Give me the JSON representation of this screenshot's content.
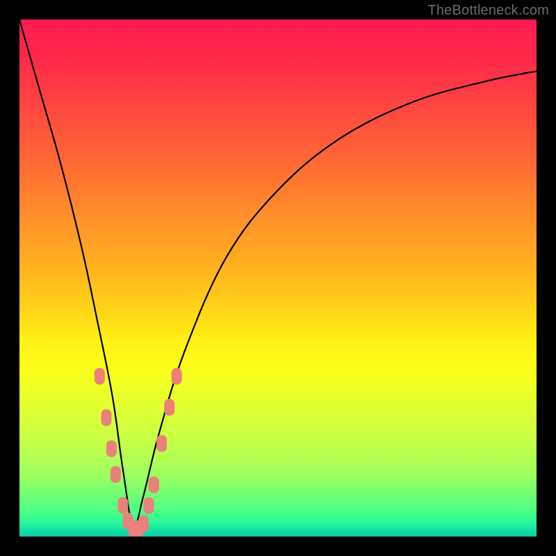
{
  "watermark": "TheBottleneck.com",
  "frame": {
    "outer_size_px": 800,
    "border_px": 28,
    "border_color": "#000000"
  },
  "gradient": {
    "direction": "vertical",
    "stops": [
      {
        "pos": 0.0,
        "color": "#ff1a52"
      },
      {
        "pos": 0.18,
        "color": "#ff4a3f"
      },
      {
        "pos": 0.38,
        "color": "#ff8f29"
      },
      {
        "pos": 0.56,
        "color": "#ffd317"
      },
      {
        "pos": 0.68,
        "color": "#faff1a"
      },
      {
        "pos": 0.8,
        "color": "#cdff40"
      },
      {
        "pos": 0.92,
        "color": "#6fff74"
      },
      {
        "pos": 1.0,
        "color": "#0bcba8"
      }
    ]
  },
  "chart_data": {
    "type": "line",
    "title": "",
    "xlabel": "",
    "ylabel": "",
    "xlim": [
      0,
      100
    ],
    "ylim": [
      0,
      100
    ],
    "grid": false,
    "note": "V-shaped bottleneck curve. x = performance index (arbitrary 0-100), y = bottleneck % (0 at minimum, 100 at top). Minimum near x≈22. Background heat gradient encodes y: red=high bottleneck, green=low.",
    "series": [
      {
        "name": "bottleneck-curve",
        "x": [
          0,
          4,
          8,
          12,
          15,
          18,
          20,
          22,
          24,
          27,
          32,
          40,
          50,
          62,
          76,
          90,
          100
        ],
        "values": [
          100,
          86,
          72,
          56,
          42,
          27,
          13,
          2,
          8,
          20,
          36,
          54,
          67,
          77,
          84,
          88,
          90
        ]
      }
    ],
    "markers": {
      "name": "highlighted-points",
      "color": "#e98079",
      "shape": "rounded-rect",
      "points": [
        {
          "x": 15.5,
          "y": 31
        },
        {
          "x": 16.8,
          "y": 23
        },
        {
          "x": 17.8,
          "y": 17
        },
        {
          "x": 18.6,
          "y": 12
        },
        {
          "x": 20.0,
          "y": 6
        },
        {
          "x": 21.0,
          "y": 3
        },
        {
          "x": 22.0,
          "y": 1.5
        },
        {
          "x": 23.0,
          "y": 1.5
        },
        {
          "x": 24.0,
          "y": 2.5
        },
        {
          "x": 25.0,
          "y": 6
        },
        {
          "x": 26.0,
          "y": 10
        },
        {
          "x": 27.5,
          "y": 18
        },
        {
          "x": 29.0,
          "y": 25
        },
        {
          "x": 30.4,
          "y": 31
        }
      ]
    }
  }
}
